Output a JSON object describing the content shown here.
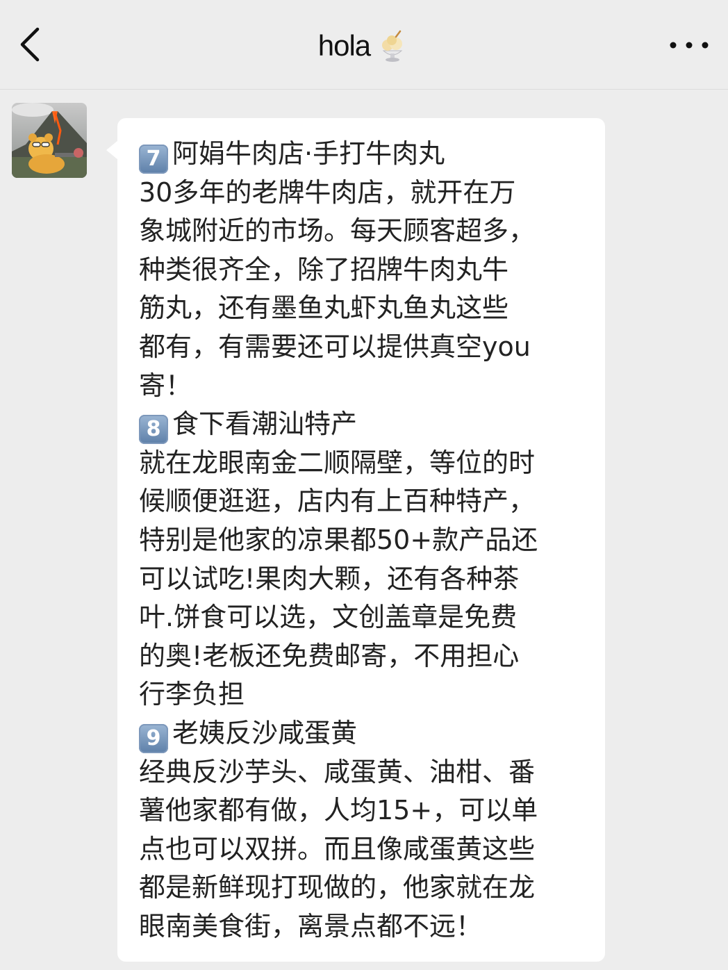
{
  "header": {
    "title": "hola",
    "title_emoji_icon": "shaved-ice-icon",
    "back_icon": "chevron-left-icon",
    "more_icon": "more-dots-icon"
  },
  "contact": {
    "avatar_icon": "avatar-bear-volcano"
  },
  "message": {
    "sections": [
      {
        "badge": "7",
        "title": "阿娟牛肉店·手打牛肉丸",
        "lines": [
          "30多年的老牌牛肉店，就开在万",
          "象城附近的市场。每天顾客超多，",
          "种类很齐全，除了招牌牛肉丸牛",
          "筋丸，还有墨鱼丸虾丸鱼丸这些",
          "都有，有需要还可以提供真空you",
          "寄！"
        ]
      },
      {
        "badge": "8",
        "title": "食下看潮汕特产",
        "lines": [
          "就在龙眼南金二顺隔壁，等位的时",
          "候顺便逛逛，店内有上百种特产，",
          "特别是他家的凉果都50+款产品还",
          "可以试吃!果肉大颗，还有各种茶",
          "叶.饼食可以选，文创盖章是免费",
          "的奥!老板还免费邮寄，不用担心",
          "行李负担"
        ]
      },
      {
        "badge": "9",
        "title": "老姨反沙咸蛋黄",
        "lines": [
          "经典反沙芋头、咸蛋黄、油柑、番",
          "薯他家都有做，人均15+，可以单",
          "点也可以双拼。而且像咸蛋黄这些",
          "都是新鲜现打现做的，他家就在龙",
          "眼南美食街，离景点都不远！"
        ]
      }
    ]
  }
}
